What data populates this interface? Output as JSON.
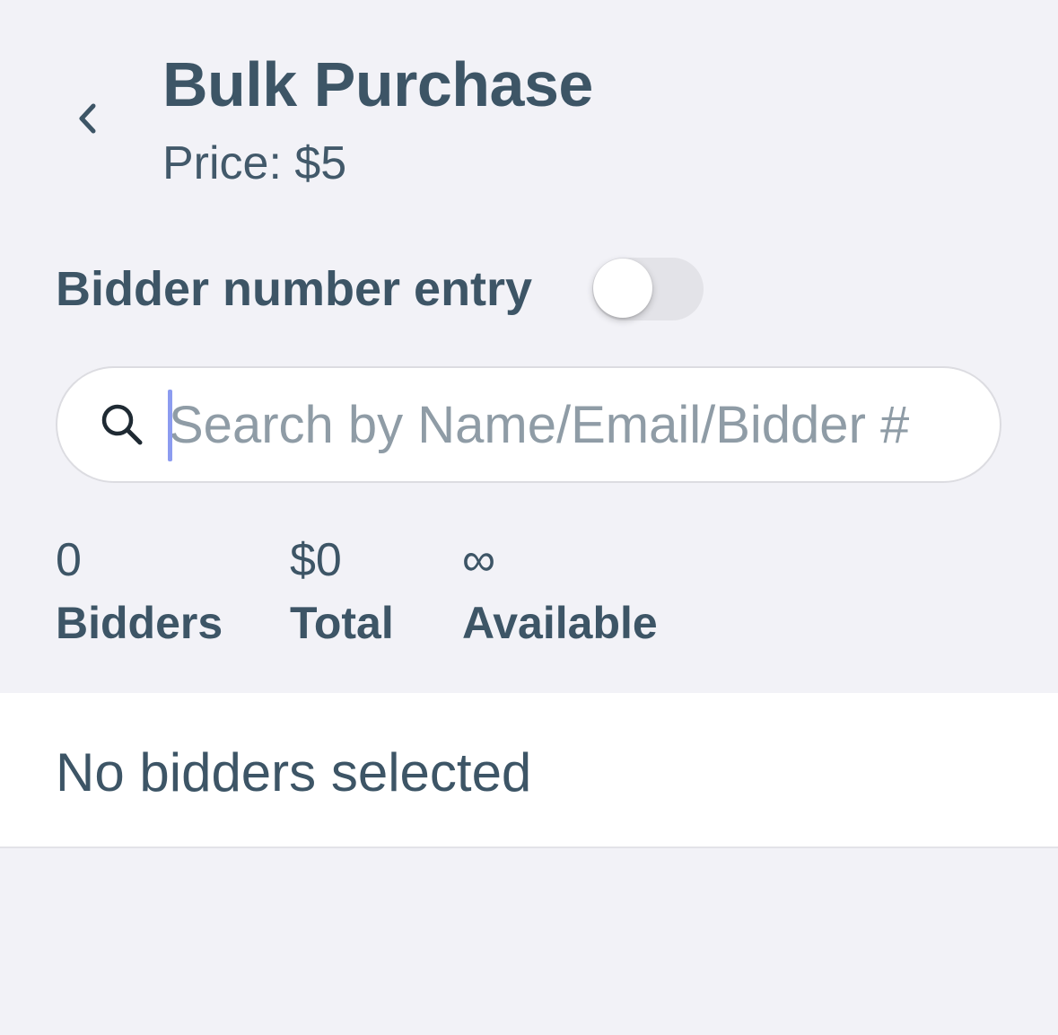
{
  "header": {
    "back_icon": "chevron-left-icon",
    "title": "Bulk Purchase",
    "price": "Price: $5"
  },
  "toggle": {
    "label": "Bidder number entry",
    "state": "off"
  },
  "search": {
    "icon": "search-icon",
    "placeholder": "Search by Name/Email/Bidder #",
    "value": ""
  },
  "stats": {
    "bidders": {
      "value": "0",
      "label": "Bidders"
    },
    "total": {
      "value": "$0",
      "label": "Total"
    },
    "available": {
      "value": "∞",
      "label": "Available"
    }
  },
  "list": {
    "empty_message": "No bidders selected"
  },
  "colors": {
    "background": "#f2f2f7",
    "text": "#3d5566",
    "placeholder": "#8f9ca6",
    "caret": "#8c9cf0",
    "toggle_track_off": "#e3e3e8"
  }
}
